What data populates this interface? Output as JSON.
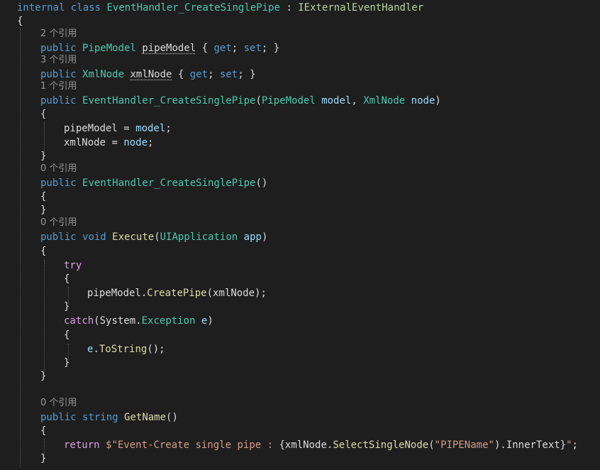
{
  "editor": {
    "class_decl": {
      "kw_internal": "internal",
      "kw_class": "class",
      "class_name": "EventHandler_CreateSinglePipe",
      "colon": " : ",
      "interface": "IExternalEventHandler"
    },
    "brace_open": "{",
    "brace_close": "}",
    "lens": {
      "pipe_model": "2 个引用",
      "xml_node": "3 个引用",
      "ctor1": "1 个引用",
      "ctor2": "0 个引用",
      "execute": "0 个引用",
      "get_name": "0 个引用"
    },
    "prop_pipe": {
      "kw_public": "public",
      "type": "PipeModel",
      "name": "pipeModel",
      "open": " { ",
      "kw_get": "get",
      "sep": "; ",
      "kw_set": "set",
      "close": "; }"
    },
    "prop_xml": {
      "kw_public": "public",
      "type": "XmlNode",
      "name": "xmlNode",
      "open": " { ",
      "kw_get": "get",
      "sep": "; ",
      "kw_set": "set",
      "close": "; }"
    },
    "ctor1": {
      "kw_public": "public",
      "name": "EventHandler_CreateSinglePipe",
      "paren_open": "(",
      "p1_type": "PipeModel",
      "p1_name": "model",
      "comma": ", ",
      "p2_type": "XmlNode",
      "p2_name": "node",
      "paren_close": ")"
    },
    "ctor1_body": {
      "l1_target": "pipeModel",
      "l1_eq": " = ",
      "l1_value": "model",
      "l1_end": ";",
      "l2_target": "xmlNode",
      "l2_eq": " = ",
      "l2_value": "node",
      "l2_end": ";"
    },
    "ctor2": {
      "kw_public": "public",
      "name": "EventHandler_CreateSinglePipe",
      "parens": "()"
    },
    "execute": {
      "kw_public": "public",
      "kw_void": "void",
      "name": "Execute",
      "paren_open": "(",
      "param_type": "UIApplication",
      "param_name": "app",
      "paren_close": ")"
    },
    "try_block": {
      "kw_try": "try",
      "call_obj": "pipeModel",
      "dot": ".",
      "call_fn": "CreatePipe",
      "call_open": "(",
      "call_arg": "xmlNode",
      "call_close": ");",
      "kw_catch": "catch",
      "catch_open": "(",
      "ns": "System",
      "ns_dot": ".",
      "ex_type": "Exception",
      "ex_name": "e",
      "catch_close": ")",
      "tostring_obj": "e",
      "tostring_dot": ".",
      "tostring_fn": "ToString",
      "tostring_end": "();"
    },
    "get_name": {
      "kw_public": "public",
      "kw_string": "string",
      "name": "GetName",
      "parens": "()"
    },
    "return_line": {
      "kw_return": "return",
      "str_start": "$\"Event-Create single pipe : ",
      "interp_open": "{",
      "obj": "xmlNode",
      "dot1": ".",
      "fn": "SelectSingleNode",
      "arg_open": "(",
      "arg": "\"PIPEName\"",
      "arg_close": ")",
      "dot2": ".",
      "prop": "InnerText",
      "interp_close": "}",
      "str_end": "\"",
      "end": ";"
    }
  }
}
